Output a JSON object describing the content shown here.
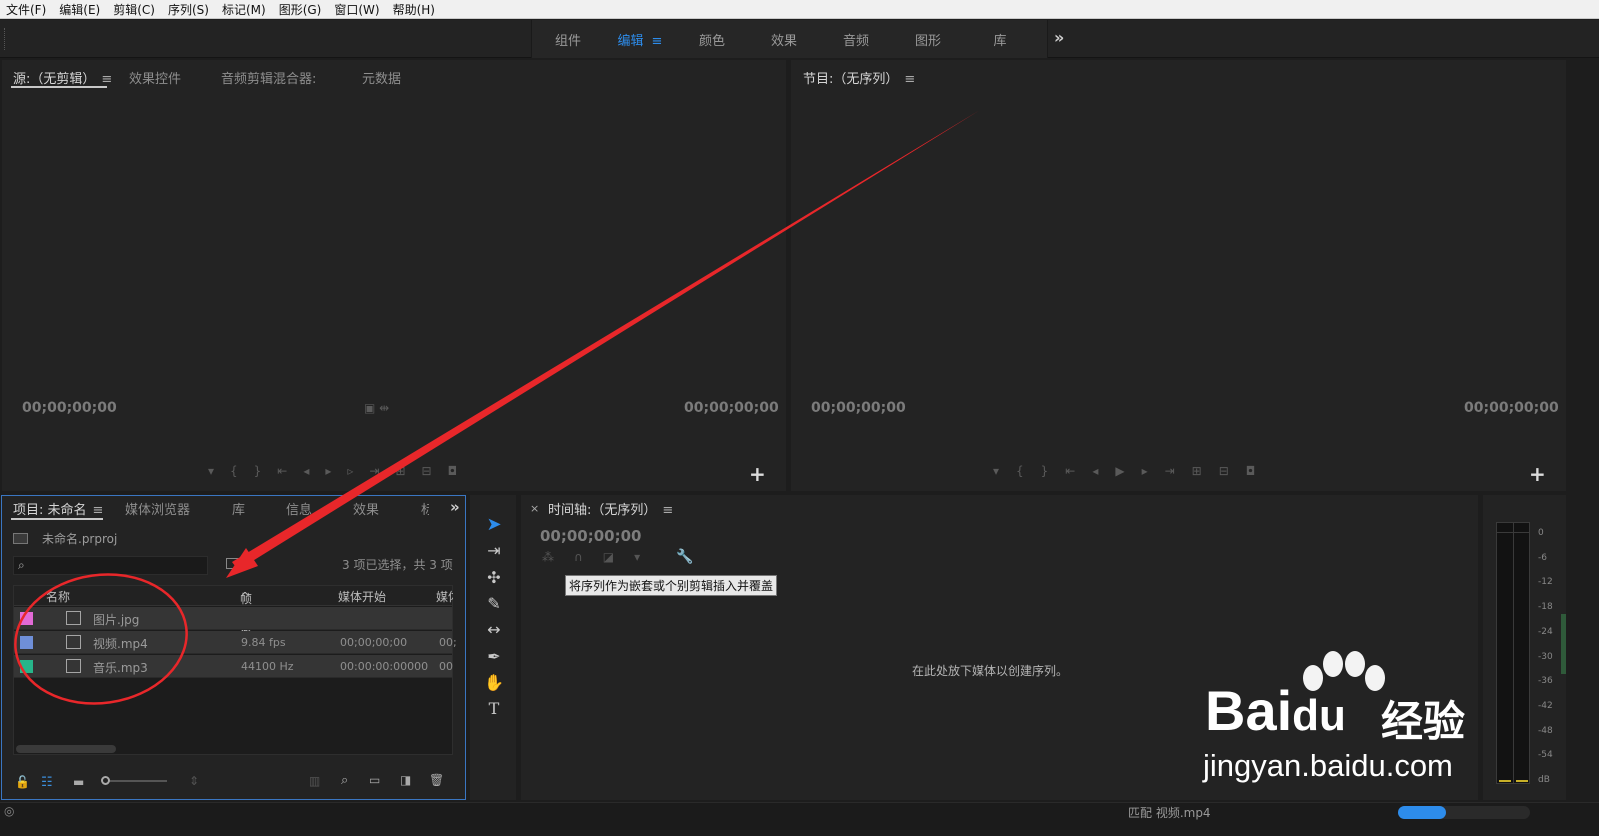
{
  "menu": [
    "文件(F)",
    "编辑(E)",
    "剪辑(C)",
    "序列(S)",
    "标记(M)",
    "图形(G)",
    "窗口(W)",
    "帮助(H)"
  ],
  "workspaces": {
    "tabs": [
      "组件",
      "编辑",
      "颜色",
      "效果",
      "音频",
      "图形",
      "库"
    ],
    "active": "编辑",
    "more": "»"
  },
  "source_panel": {
    "tabs": [
      "源:（无剪辑）",
      "效果控件",
      "音频剪辑混合器:",
      "元数据"
    ],
    "tc_left": "00;00;00;00",
    "tc_right": "00;00;00;00"
  },
  "program_panel": {
    "title": "节目:（无序列）",
    "tc_left": "00;00;00;00",
    "tc_right": "00;00;00;00"
  },
  "project_panel": {
    "tabs": [
      "项目: 未命名",
      "媒体浏览器",
      "库",
      "信息",
      "效果",
      "标"
    ],
    "project_file": "未命名.prproj",
    "selection_status": "3 项已选择，共 3 项",
    "columns": [
      "名称",
      "帧速率",
      "媒体开始",
      "媒体"
    ],
    "rows": [
      {
        "name": "图片.jpg",
        "fps": "",
        "start": "",
        "color": "#e26ad6"
      },
      {
        "name": "视频.mp4",
        "fps": "9.84 fps",
        "start": "00;00;00;00",
        "end": "00;",
        "color": "#6f8fd8"
      },
      {
        "name": "音乐.mp3",
        "fps": "44100 Hz",
        "start": "00:00:00:00000",
        "end": "00",
        "color": "#27b58a"
      }
    ]
  },
  "timeline_panel": {
    "title": "时间轴:（无序列）",
    "timecode": "00;00;00;00",
    "tooltip": "将序列作为嵌套或个别剪辑插入并覆盖",
    "drop_hint": "在此处放下媒体以创建序列。"
  },
  "audio_meter": {
    "labels": [
      "0",
      "-6",
      "-12",
      "-18",
      "-24",
      "-30",
      "-36",
      "-42",
      "-48",
      "-54",
      "dB"
    ]
  },
  "status_bar": {
    "text": "匹配 视频.mp4"
  },
  "watermark": {
    "brand": "Bai",
    "brand_suffix": "du",
    "chinese": "经验",
    "url": "jingyan.baidu.com"
  },
  "colors": {
    "accent_blue": "#2d8ceb",
    "annotation_red": "#e8272a"
  }
}
